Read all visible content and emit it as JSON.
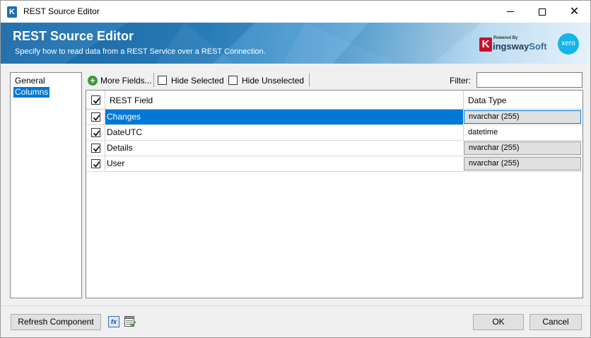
{
  "window": {
    "title": "REST Source Editor",
    "icon": "kingswaysoft-k-icon",
    "controls": [
      "minimize-icon",
      "maximize-icon",
      "close-icon"
    ]
  },
  "banner": {
    "title": "REST Source Editor",
    "subtitle": "Specify how to read data from a REST Service over a REST Connection.",
    "powered_by": "Powered By",
    "brand_k": "K",
    "brand_mid": "ingsway",
    "brand_end": "Soft",
    "xero": "xero"
  },
  "nav": {
    "items": [
      {
        "label": "General",
        "selected": false
      },
      {
        "label": "Columns",
        "selected": true
      }
    ]
  },
  "toolbar": {
    "more_fields": "More Fields...",
    "hide_selected": "Hide Selected",
    "hide_unselected": "Hide Unselected",
    "filter_label": "Filter:",
    "filter_value": ""
  },
  "grid": {
    "columns": [
      "REST Field",
      "Data Type"
    ],
    "header_checked": true,
    "rows": [
      {
        "field": "Changes",
        "type": "nvarchar (255)",
        "checked": true,
        "selected": true,
        "combo": true
      },
      {
        "field": "DateUTC",
        "type": "datetime",
        "checked": true,
        "selected": false,
        "combo": false
      },
      {
        "field": "Details",
        "type": "nvarchar (255)",
        "checked": true,
        "selected": false,
        "combo": true
      },
      {
        "field": "User",
        "type": "nvarchar (255)",
        "checked": true,
        "selected": false,
        "combo": true
      }
    ]
  },
  "footer": {
    "refresh": "Refresh Component",
    "expression_icon": "fx",
    "ok": "OK",
    "cancel": "Cancel"
  },
  "colors": {
    "accent": "#0078d7",
    "banner_start": "#1a6aa9",
    "brand_red": "#c8102e",
    "xero_blue": "#13b5ea"
  }
}
